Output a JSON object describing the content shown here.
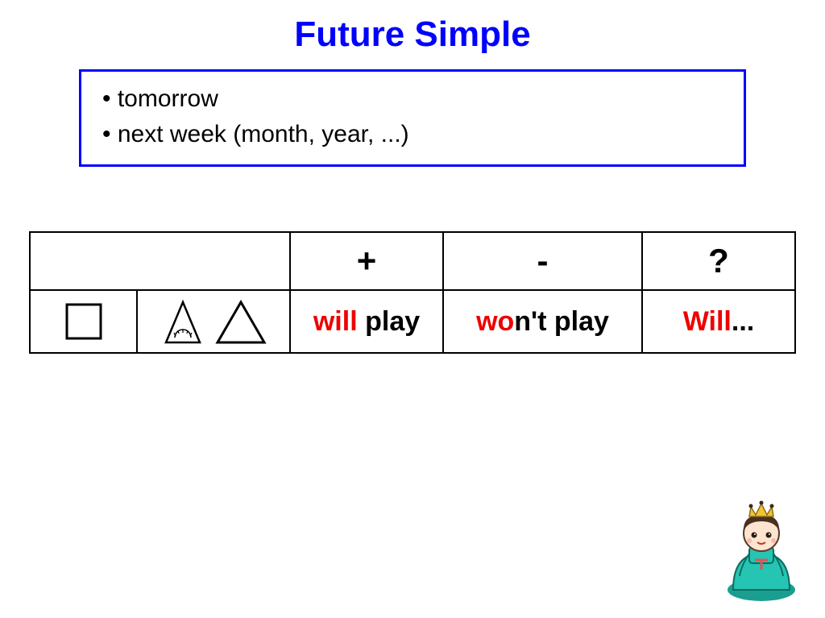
{
  "title": "Future Simple",
  "bullets": [
    "tomorrow",
    "next week (month, year, ...)"
  ],
  "tableHeader": {
    "plus": "+",
    "minus": "-",
    "question": "?"
  },
  "tableRow": {
    "plus_red": "will",
    "plus_black": " play",
    "minus_red": "wo",
    "minus_black": "n't play",
    "question_red": "Will",
    "question_black": "..."
  }
}
